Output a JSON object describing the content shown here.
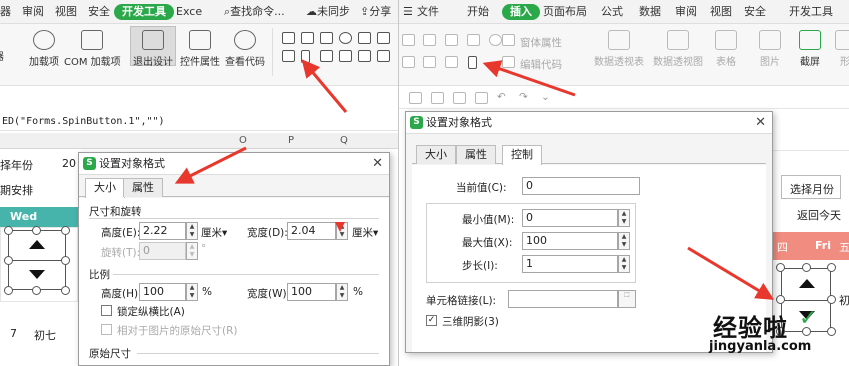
{
  "left": {
    "menu": [
      "器",
      "审阅",
      "视图",
      "安全",
      "开发工具",
      "Exce",
      "查找命令...",
      "未同步",
      "分享"
    ],
    "ribbon": {
      "buttons": [
        "器",
        "加载项",
        "COM 加载项",
        "退出设计",
        "控件属性",
        "查看代码"
      ]
    },
    "formula": "ED(\"Forms.SpinButton.1\",\"\")",
    "columns": [
      "O",
      "P",
      "Q"
    ],
    "cells": [
      "择年份",
      "20",
      "期安排",
      "7",
      "初七"
    ],
    "wed_header": "Wed",
    "dialog": {
      "title": "设置对象格式",
      "tabs": [
        "大小",
        "属性"
      ],
      "size_rotate_label": "尺寸和旋转",
      "height_label": "高度(E):",
      "height_value": "2.22",
      "width_label": "宽度(D):",
      "width_value": "2.04",
      "unit": "厘米",
      "rotate_label": "旋转(T):",
      "rotate_value": "0",
      "degree": "°",
      "scale_label": "比例",
      "scale_h_label": "高度(H):",
      "scale_h_value": "100",
      "scale_w_label": "宽度(W):",
      "scale_w_value": "100",
      "percent": "%",
      "lock_ratio": "锁定纵横比(A)",
      "relative_original": "相对于图片的原始尺寸(R)",
      "original_size": "原始尺寸"
    }
  },
  "right": {
    "menu": [
      "文件",
      "开始",
      "插入",
      "页面布局",
      "公式",
      "数据",
      "审阅",
      "视图",
      "安全",
      "开发工具"
    ],
    "ribbon_labels": [
      "窗体属性",
      "编辑代码",
      "数据透视表",
      "数据透视图",
      "表格",
      "图片",
      "截屏",
      "形"
    ],
    "cells": [
      "选择月份",
      "返回今天",
      "四",
      "Fri",
      "五",
      "初"
    ],
    "dialog": {
      "title": "设置对象格式",
      "tabs": [
        "大小",
        "属性",
        "控制"
      ],
      "current_label": "当前值(C):",
      "current_value": "0",
      "min_label": "最小值(M):",
      "min_value": "0",
      "max_label": "最大值(X):",
      "max_value": "100",
      "step_label": "步长(I):",
      "step_value": "1",
      "link_label": "单元格链接(L):",
      "link_value": "",
      "shading_label": "三维阴影(3)",
      "shading_checked": true
    },
    "watermark": {
      "line1": "经验啦",
      "check": "✓",
      "line2": "jingyanla.com"
    }
  },
  "colors": {
    "green": "#2ba84a",
    "accent_pink": "#f08c80",
    "teal": "#46b4aa",
    "arrow_red": "#e8382e"
  }
}
